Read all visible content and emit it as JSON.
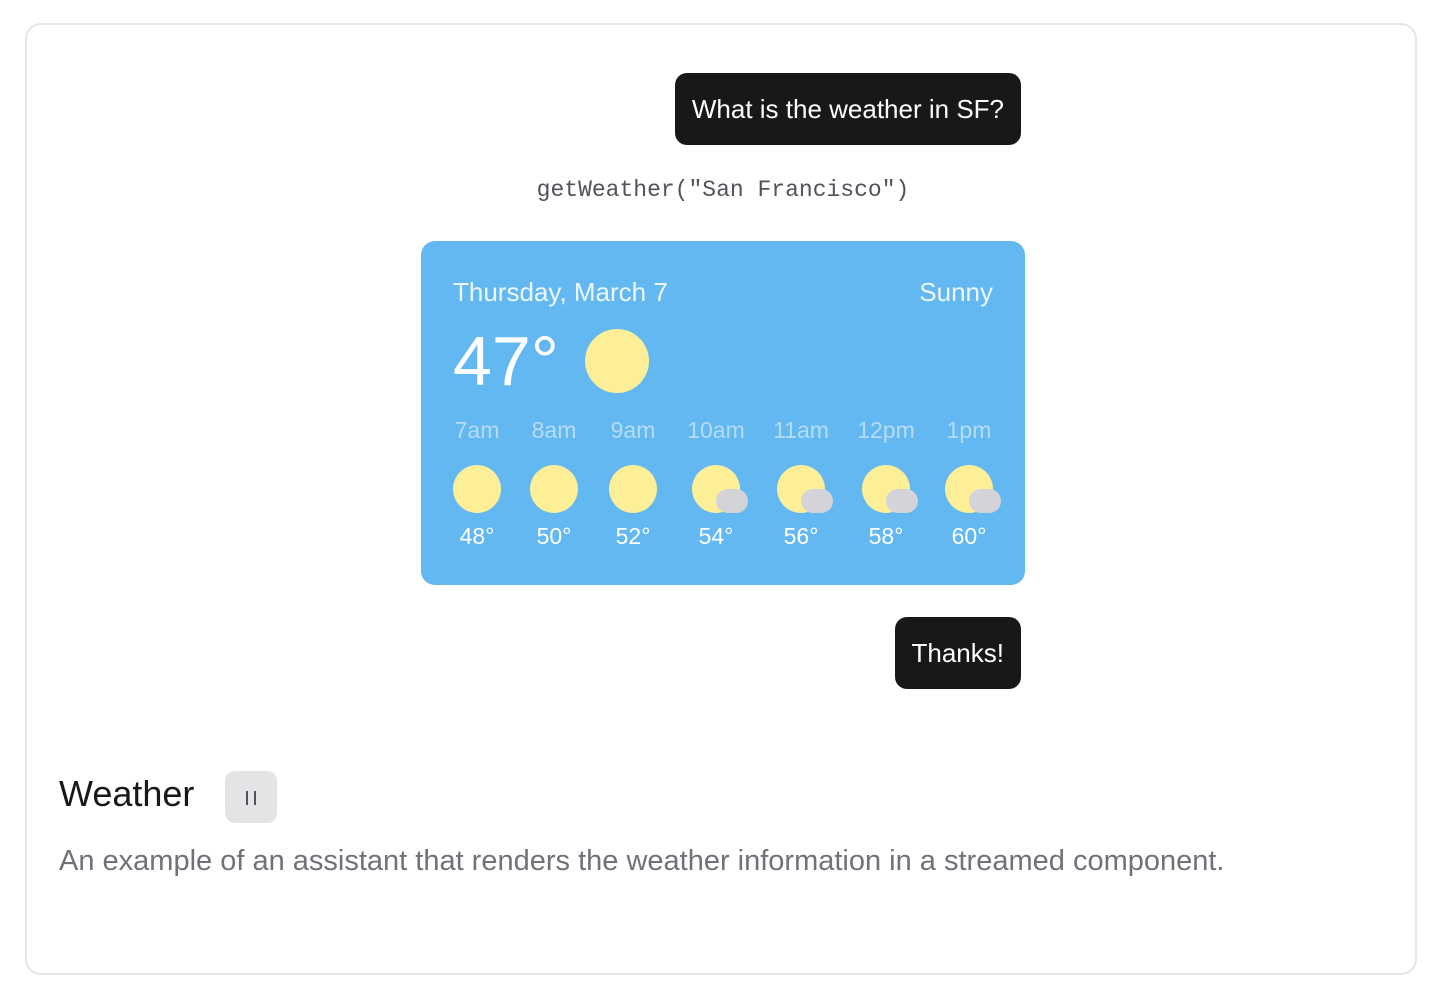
{
  "chat": {
    "user_question": "What is the weather in SF?",
    "tool_call": "getWeather(\"San Francisco\")",
    "user_reply": "Thanks!"
  },
  "weather": {
    "date": "Thursday, March 7",
    "condition": "Sunny",
    "temperature": "47°",
    "icon": "sun-icon",
    "hourly": [
      {
        "time": "7am",
        "temp": "48°",
        "icon": "sun-icon"
      },
      {
        "time": "8am",
        "temp": "50°",
        "icon": "sun-icon"
      },
      {
        "time": "9am",
        "temp": "52°",
        "icon": "sun-icon"
      },
      {
        "time": "10am",
        "temp": "54°",
        "icon": "partly-cloudy-icon"
      },
      {
        "time": "11am",
        "temp": "56°",
        "icon": "partly-cloudy-icon"
      },
      {
        "time": "12pm",
        "temp": "58°",
        "icon": "partly-cloudy-icon"
      },
      {
        "time": "1pm",
        "temp": "60°",
        "icon": "partly-cloudy-icon"
      }
    ]
  },
  "footer": {
    "title": "Weather",
    "description": "An example of an assistant that renders the weather information in a streamed component.",
    "pause_icon": "pause-icon"
  },
  "colors": {
    "bubble_bg": "#18181b",
    "weather_card_bg": "#63b8f2",
    "sun": "#fcef97",
    "cloud": "#d4d4d8"
  }
}
